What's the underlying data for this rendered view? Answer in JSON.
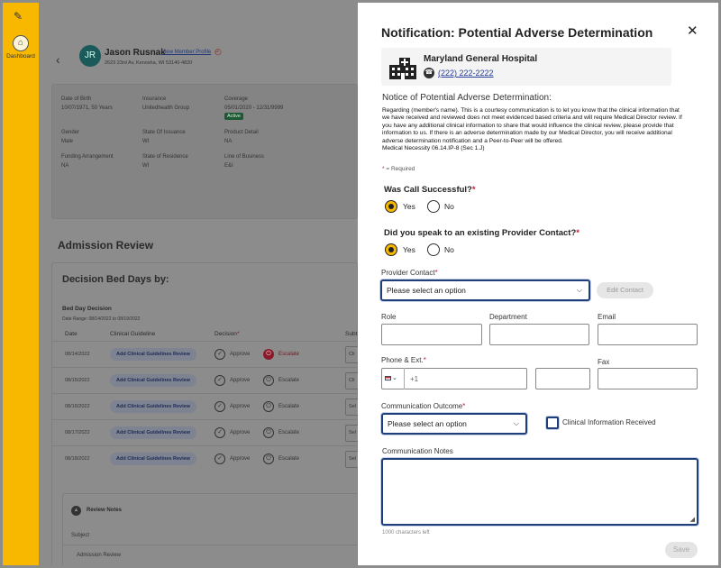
{
  "rail": {
    "logo_icon": "brand-logo-icon",
    "home_label": "Dashboard"
  },
  "patient": {
    "initials": "JR",
    "name": "Jason Rusnak",
    "profile_link": "View Member Profile",
    "address": "2623 23rd Av, Kenosha, WI 53140-4820"
  },
  "info": {
    "dob_label": "Date of Birth",
    "dob": "10/07/1971, 50 Years",
    "insurance_label": "Insurance",
    "insurance": "Unitedhealth Group",
    "coverage_label": "Coverage",
    "coverage": "05/01/2020 - 12/31/9999",
    "coverage_status": "Active",
    "gender_label": "Gender",
    "gender": "Male",
    "state_ins_label": "State Of Issuance",
    "state_ins": "WI",
    "product_label": "Product Detail",
    "product": "NA",
    "funding_label": "Funding Arrangement",
    "funding": "NA",
    "residence_label": "State of Residence",
    "residence": "WI",
    "lob_label": "Line of Business",
    "lob": "E&I"
  },
  "admission": {
    "title": "Admission Review",
    "decision_title": "Decision Bed Days by:",
    "bdd_title": "Bed Day Decision",
    "bdd_range": "Date Range: 08/14/2022 to 08/19/2022",
    "col_date": "Date",
    "col_guideline": "Clinical Guideline",
    "col_decision": "Decision",
    "col_sub": "Subt",
    "approve_label": "Approve",
    "escalate_label": "Escalate",
    "guideline_btn": "Add Clinical Guidelines Review",
    "rows": [
      {
        "date": "08/14/2022",
        "sel": "Cli"
      },
      {
        "date": "08/15/2022",
        "sel": "Cli"
      },
      {
        "date": "08/16/2022",
        "sel": "Sel"
      },
      {
        "date": "08/17/2022",
        "sel": "Sel"
      },
      {
        "date": "08/18/2022",
        "sel": "Sel"
      }
    ],
    "review_notes": "Review Notes",
    "subject_label": "Subject",
    "subject_value": "Admission Review"
  },
  "modal": {
    "title": "Notification: Potential Adverse Determination",
    "hospital_name": "Maryland General Hospital",
    "hospital_phone": "(222) 222-2222",
    "notice_title": "Notice of Potential Adverse Determination:",
    "notice_body": "Regarding (member's name).  This is a courtesy communication is to let you know that the clinical information that we have received and reviewed does not meet evidenced based criteria and will require Medical Director review. If you have any additional clinical information to share that would influence the clinical review, please provide that information to us.  If there is an adverse determination made by our Medical Director, you will receive additional adverse determination notification and a Peer-to-Peer will be offered.",
    "notice_ref": "Medical Necessity 06.14.IP-8 (Sec 1.J)",
    "required_note": "= Required",
    "q1": "Was Call Successful?",
    "q2": "Did you speak to an existing Provider Contact?",
    "yes": "Yes",
    "no": "No",
    "provider_contact_label": "Provider Contact",
    "provider_contact_value": "Please select an option",
    "edit_contact": "Edit Contact",
    "role_label": "Role",
    "department_label": "Department",
    "email_label": "Email",
    "phone_label": "Phone & Ext.",
    "phone_prefix": "+1",
    "fax_label": "Fax",
    "outcome_label": "Communication Outcome",
    "outcome_value": "Please select an option",
    "clinical_received": "Clinical Information Received",
    "notes_label": "Communication Notes",
    "chars_left": "1000 characters left",
    "save": "Save"
  }
}
